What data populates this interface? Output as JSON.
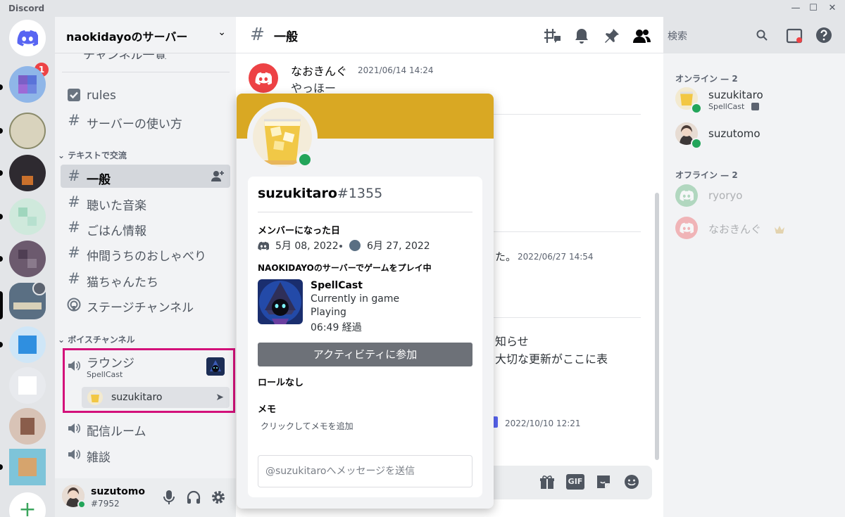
{
  "window": {
    "app_title": "Discord"
  },
  "rail": {
    "home_badge": "1"
  },
  "server": {
    "name": "naokidayoのサーバー",
    "partial_item": "チャンネル一覧"
  },
  "channels": {
    "rules": "rules",
    "guide": "サーバーの使い方",
    "text_category": "テキストで交流",
    "general": "一般",
    "music": "聴いた音楽",
    "food": "ごはん情報",
    "chat": "仲間うちのおしゃべり",
    "cats": "猫ちゃんたち",
    "stage": "ステージチャンネル",
    "voice_category": "ボイスチャンネル",
    "lounge": "ラウンジ",
    "lounge_activity": "SpellCast",
    "lounge_user": "suzukitaro",
    "stream": "配信ルーム",
    "talk": "雑談"
  },
  "user_panel": {
    "name": "suzutomo",
    "tag": "#7952"
  },
  "chat": {
    "channel": "一般",
    "msg1_author": "なおきんぐ",
    "msg1_time": "2021/06/14 14:24",
    "msg1_text": "やっほー",
    "msg2_tail": "た。",
    "msg2_time": "2022/06/27 14:54",
    "msg3_line1": "知らせ",
    "msg3_line2": "大切な更新がここに表",
    "msg4_time": "2022/10/10 12:21"
  },
  "search": {
    "placeholder": "検索"
  },
  "members": {
    "online_header": "オンライン — 2",
    "offline_header": "オフライン — 2",
    "online": [
      {
        "name": "suzukitaro",
        "activity": "SpellCast"
      },
      {
        "name": "suzutomo"
      }
    ],
    "offline": [
      {
        "name": "ryoryo"
      },
      {
        "name": "なおきんぐ"
      }
    ]
  },
  "popout": {
    "username": "suzukitaro",
    "discriminator": "#1355",
    "member_since_title": "メンバーになった日",
    "discord_since": "5月 08, 2022",
    "server_since": "6月 27, 2022",
    "playing_title": "NAOKIDAYOのサーバーでゲームをプレイ中",
    "game_name": "SpellCast",
    "game_status": "Currently in game",
    "game_state": "Playing",
    "game_elapsed": "06:49 経過",
    "join_button": "アクティビティに参加",
    "roles_title": "ロールなし",
    "note_title": "メモ",
    "note_placeholder": "クリックしてメモを追加",
    "dm_placeholder": "@suzukitaroへメッセージを送信"
  },
  "colors": {
    "brand": "#5865f2",
    "danger": "#ed4245",
    "online": "#23a55a",
    "banner": "#d9a823",
    "highlight": "#d3117a"
  }
}
